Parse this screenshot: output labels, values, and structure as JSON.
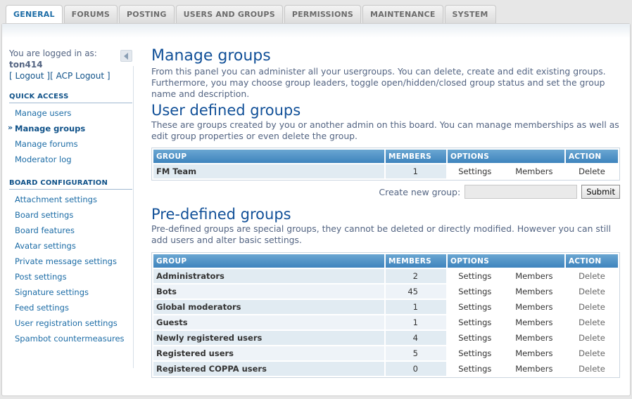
{
  "tabs": [
    "GENERAL",
    "FORUMS",
    "POSTING",
    "USERS AND GROUPS",
    "PERMISSIONS",
    "MAINTENANCE",
    "SYSTEM"
  ],
  "login": {
    "label": "You are logged in as:",
    "username": "ton414",
    "logout": "[ Logout ]",
    "acp_logout": "[ ACP Logout ]"
  },
  "quick_access": {
    "title": "QUICK ACCESS",
    "items": [
      "Manage users",
      "Manage groups",
      "Manage forums",
      "Moderator log"
    ]
  },
  "board_config": {
    "title": "BOARD CONFIGURATION",
    "items": [
      "Attachment settings",
      "Board settings",
      "Board features",
      "Avatar settings",
      "Private message settings",
      "Post settings",
      "Signature settings",
      "Feed settings",
      "User registration settings",
      "Spambot countermeasures"
    ]
  },
  "main": {
    "title": "Manage groups",
    "description": "From this panel you can administer all your usergroups. You can delete, create and edit existing groups. Furthermore, you may choose group leaders, toggle open/hidden/closed group status and set the group name and description.",
    "user_defined": {
      "title": "User defined groups",
      "description": "These are groups created by you or another admin on this board. You can manage memberships as well as edit group properties or even delete the group."
    },
    "predefined": {
      "title": "Pre-defined groups",
      "description": "Pre-defined groups are special groups, they cannot be deleted or directly modified. However you can still add users and alter basic settings."
    },
    "create_label": "Create new group:",
    "submit": "Submit"
  },
  "table_headers": {
    "group": "GROUP",
    "members": "MEMBERS",
    "options": "OPTIONS",
    "action": "ACTION"
  },
  "row_labels": {
    "settings": "Settings",
    "members": "Members",
    "delete": "Delete"
  },
  "user_groups": [
    {
      "name": "FM Team",
      "members": "1"
    }
  ],
  "predefined_groups": [
    {
      "name": "Administrators",
      "members": "2"
    },
    {
      "name": "Bots",
      "members": "45"
    },
    {
      "name": "Global moderators",
      "members": "1"
    },
    {
      "name": "Guests",
      "members": "1"
    },
    {
      "name": "Newly registered users",
      "members": "4"
    },
    {
      "name": "Registered users",
      "members": "5"
    },
    {
      "name": "Registered COPPA users",
      "members": "0"
    }
  ]
}
